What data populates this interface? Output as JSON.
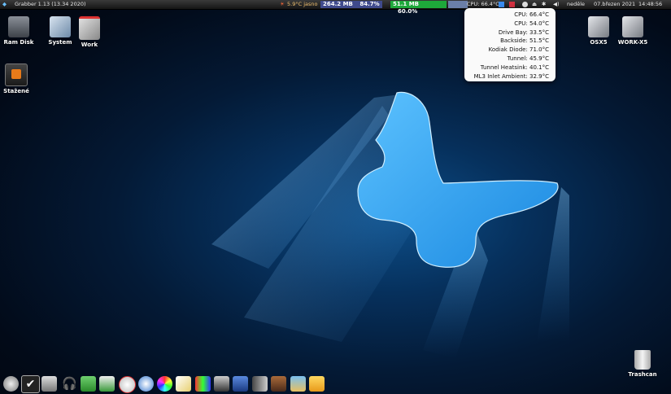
{
  "menubar": {
    "app_title": "Grabber 1.13 (13.34 2020)",
    "weather": "5.9°C jasno",
    "mem1": "264.2 MB",
    "mem1_pct": "84.7%",
    "mem2": "51.1 MB",
    "mem2_pct": "60.0%",
    "cpu": "CPU: 66.4°C",
    "day": "neděle",
    "date": "07.březen 2021",
    "time": "14:48:56"
  },
  "desktop_icons": {
    "ramdisk": "Ram Disk",
    "system": "System",
    "work": "Work",
    "stazene": "Stažené",
    "osx5": "OSX5",
    "workx5": "WORK-X5",
    "trash": "Trashcan"
  },
  "temps": [
    "CPU: 66.4°C",
    "CPU: 54.0°C",
    "Drive Bay: 33.5°C",
    "Backside: 51.5°C",
    "Kodiak Diode: 71.0°C",
    "Tunnel: 45.9°C",
    "Tunnel Heatsink: 40.1°C",
    "ML3 Inlet Ambient: 32.9°C"
  ],
  "colors": {
    "mem1_bg": "#3f4a8c",
    "mem2_bg": "#1ea83a",
    "butterfly": "#2a9ce8"
  },
  "dock_icons": [
    "disc-icon",
    "check-icon",
    "media-icon",
    "headphones-icon",
    "download-icon",
    "stack-icon",
    "clock-icon",
    "compass-icon",
    "color-wheel-icon",
    "pencil-icon",
    "colors-icon",
    "film-icon",
    "clapper-icon",
    "cube-icon",
    "movie-icon",
    "picture-icon",
    "note-icon"
  ]
}
